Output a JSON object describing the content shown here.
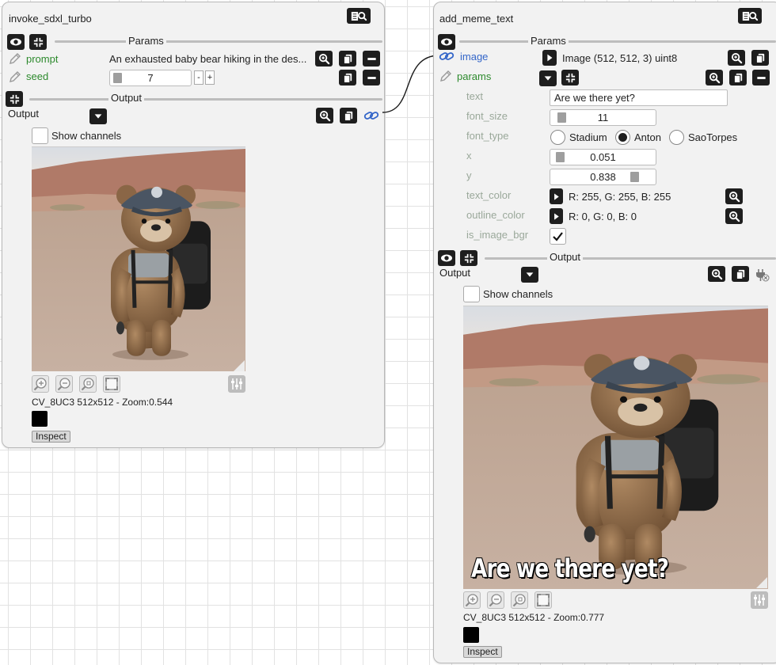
{
  "colors": {
    "accent_green": "#2d8a2d",
    "link_blue": "#3466c9",
    "button_dark": "#1e1e1e",
    "panel_bg": "#f2f2f2"
  },
  "left_node": {
    "title": "invoke_sdxl_turbo",
    "params_header": "Params",
    "params": [
      {
        "label": "prompt",
        "value": "An exhausted baby bear hiking in the des..."
      },
      {
        "label": "seed",
        "value": "7",
        "minus": "-",
        "plus": "+"
      }
    ],
    "output_header": "Output",
    "output_label": "Output",
    "show_channels": "Show channels",
    "image_info": "CV_8UC3 512x512 - Zoom:0.544",
    "inspect_label": "Inspect"
  },
  "right_node": {
    "title": "add_meme_text",
    "params_header": "Params",
    "image_label": "image",
    "image_value": "Image (512, 512, 3) uint8",
    "params_label": "params",
    "sub_params": {
      "text_label": "text",
      "text_value": "Are we there yet?",
      "font_size_label": "font_size",
      "font_size_value": "11",
      "font_type_label": "font_type",
      "font_options": [
        "Stadium",
        "Anton",
        "SaoTorpes"
      ],
      "font_selected": "Anton",
      "x_label": "x",
      "x_value": "0.051",
      "y_label": "y",
      "y_value": "0.838",
      "text_color_label": "text_color",
      "text_color_value": "R: 255, G: 255, B: 255",
      "outline_color_label": "outline_color",
      "outline_color_value": "R: 0, G: 0, B: 0",
      "is_image_bgr_label": "is_image_bgr",
      "is_image_bgr_checked": true
    },
    "output_header": "Output",
    "output_label": "Output",
    "show_channels": "Show channels",
    "meme_caption": "Are we there yet?",
    "image_info": "CV_8UC3 512x512 - Zoom:0.777",
    "inspect_label": "Inspect"
  },
  "icons": [
    "doc-search-icon",
    "eye-icon",
    "collapse-icon",
    "pencil-icon",
    "zoom-icon",
    "copy-icon",
    "minus-icon",
    "dropdown-icon",
    "link-icon",
    "play-icon",
    "plug-off-icon",
    "zoom-in-icon",
    "zoom-out-icon",
    "zoom-fit-icon",
    "full-size-icon",
    "settings-sliders-icon"
  ]
}
